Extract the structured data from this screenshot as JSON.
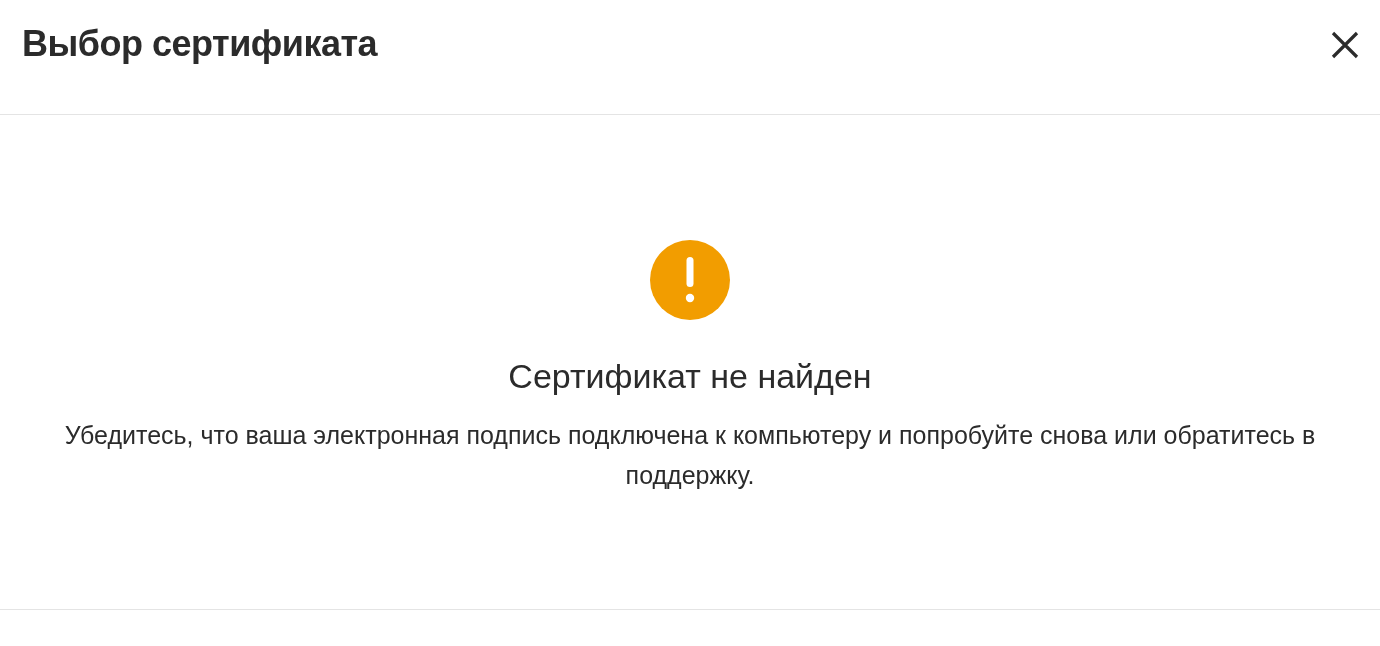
{
  "dialog": {
    "title": "Выбор сертификата"
  },
  "message": {
    "heading": "Сертификат не найден",
    "text": "Убедитесь, что ваша электронная подпись подключена к компьютеру и попробуйте снова или обратитесь в поддержку."
  }
}
